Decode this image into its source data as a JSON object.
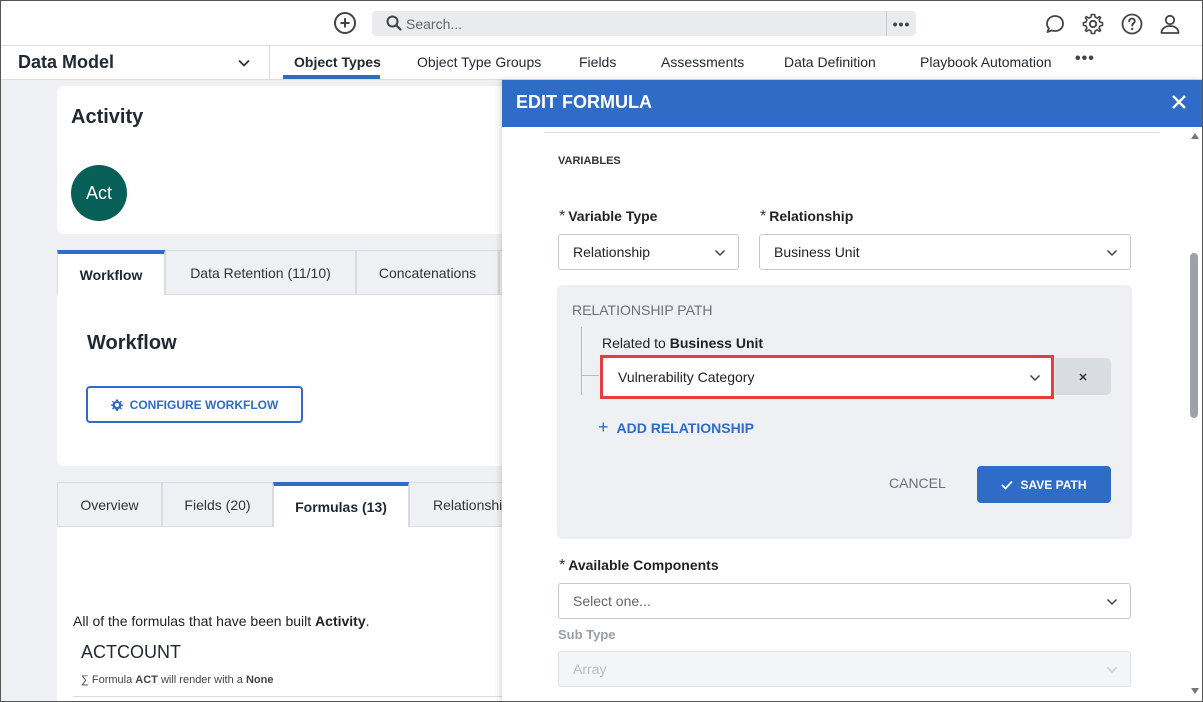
{
  "topbar": {
    "search_placeholder": "Search...",
    "icons": [
      "add-circle-icon",
      "search-icon",
      "more-icon",
      "chat-icon",
      "gear-icon",
      "help-icon",
      "user-icon"
    ]
  },
  "nav": {
    "title": "Data Model",
    "tabs": [
      {
        "label": "Object Types",
        "active": true
      },
      {
        "label": "Object Type Groups"
      },
      {
        "label": "Fields"
      },
      {
        "label": "Assessments"
      },
      {
        "label": "Data Definition"
      },
      {
        "label": "Playbook Automation"
      }
    ],
    "more": "•••"
  },
  "activity": {
    "title": "Activity",
    "avatar_text": "Act",
    "avatar_color": "#075f58"
  },
  "workflow_card": {
    "tabs": [
      "Workflow",
      "Data Retention (11/10)",
      "Concatenations"
    ],
    "heading": "Workflow",
    "configure_button": "CONFIGURE WORKFLOW"
  },
  "formulas_card": {
    "tabs": [
      "Overview",
      "Fields (20)",
      "Formulas (13)",
      "Relationshi"
    ],
    "desc_prefix": "All of the formulas that have been built ",
    "desc_object": "Activity",
    "desc_suffix": ".",
    "formula_name": "ACTCOUNT",
    "note_prefix": "∑ Formula ",
    "note_code": "ACT",
    "note_middle": " will render with a ",
    "note_value": "None"
  },
  "modal": {
    "title": "EDIT FORMULA",
    "variables_label": "VARIABLES",
    "variable_type_label": "Variable Type",
    "variable_type_value": "Relationship",
    "relationship_label": "Relationship",
    "relationship_value": "Business Unit",
    "rel_path": {
      "title": "RELATIONSHIP PATH",
      "related_prefix": "Related to ",
      "related_object": "Business Unit",
      "selected": "Vulnerability Category",
      "add_label": "ADD RELATIONSHIP",
      "cancel": "CANCEL",
      "save": "SAVE PATH"
    },
    "available_components_label": "Available Components",
    "available_components_placeholder": "Select one...",
    "sub_type_label": "Sub Type",
    "sub_type_value": "Array"
  },
  "colors": {
    "accent": "#2e6cc8",
    "highlight": "#e53e3e"
  }
}
